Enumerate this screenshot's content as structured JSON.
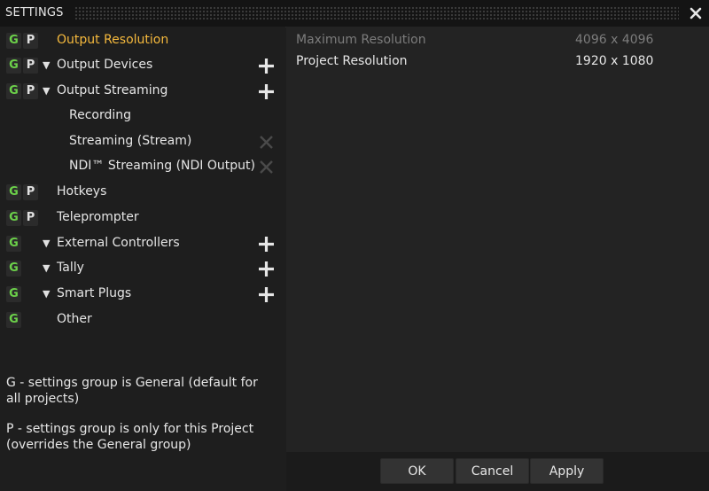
{
  "window": {
    "title": "SETTINGS",
    "close_icon": "close-icon"
  },
  "colors": {
    "general_badge": "#6cd24a",
    "active_item": "#f5b93d",
    "disabled": "#7c7c7c"
  },
  "nav": {
    "items": [
      {
        "label": "Output Resolution",
        "badges": [
          "G",
          "P"
        ],
        "active": true
      },
      {
        "label": "Output Devices",
        "badges": [
          "G",
          "P"
        ],
        "expanded": true,
        "action": "add"
      },
      {
        "label": "Output Streaming",
        "badges": [
          "G",
          "P"
        ],
        "expanded": true,
        "action": "add"
      },
      {
        "label": "Recording",
        "sub": true
      },
      {
        "label": "Streaming (Stream)",
        "sub": true,
        "action": "remove"
      },
      {
        "label": "NDI™ Streaming (NDI Output)",
        "sub": true,
        "action": "remove"
      },
      {
        "label": "Hotkeys",
        "badges": [
          "G",
          "P"
        ]
      },
      {
        "label": "Teleprompter",
        "badges": [
          "G",
          "P"
        ]
      },
      {
        "label": "External Controllers",
        "badges": [
          "G"
        ],
        "expanded": true,
        "action": "add"
      },
      {
        "label": "Tally",
        "badges": [
          "G"
        ],
        "expanded": true,
        "action": "add"
      },
      {
        "label": "Smart Plugs",
        "badges": [
          "G"
        ],
        "expanded": true,
        "action": "add"
      },
      {
        "label": "Other",
        "badges": [
          "G"
        ]
      }
    ],
    "badge_g": "G",
    "badge_p": "P",
    "expand_arrow": "▼"
  },
  "legend": {
    "general": "G - settings group is General (default for all projects)",
    "project": "P - settings group is only for this Project (overrides the General group)"
  },
  "properties": [
    {
      "name": "Maximum Resolution",
      "value": "4096 x 4096",
      "disabled": true
    },
    {
      "name": "Project Resolution",
      "value": "1920 x 1080",
      "disabled": false
    }
  ],
  "footer": {
    "ok": "OK",
    "cancel": "Cancel",
    "apply": "Apply"
  }
}
